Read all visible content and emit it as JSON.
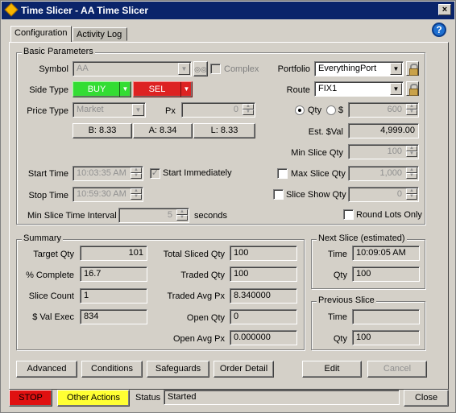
{
  "window": {
    "title": "Time Slicer - AA Time Slicer",
    "close_glyph": "×"
  },
  "tabs": [
    {
      "label": "Configuration"
    },
    {
      "label": "Activity Log"
    }
  ],
  "help_glyph": "?",
  "basic": {
    "group_label": "Basic Parameters",
    "symbol_label": "Symbol",
    "symbol_value": "AA",
    "complex_label": "Complex",
    "side_label": "Side Type",
    "buy_label": "BUY",
    "sell_label": "SEL",
    "price_type_label": "Price Type",
    "price_type_value": "Market",
    "px_label": "Px",
    "px_value": "0",
    "bid": "B: 8.33",
    "ask": "A: 8.34",
    "last": "L: 8.33",
    "start_time_label": "Start Time",
    "start_time_value": "10:03:35 AM",
    "start_immediately_label": "Start Immediately",
    "start_immediately_glyph": "✓",
    "stop_time_label": "Stop Time",
    "stop_time_value": "10:59:30 AM",
    "min_slice_interval_label": "Min Slice Time Interval",
    "min_slice_interval_value": "5",
    "seconds_label": "seconds",
    "portfolio_label": "Portfolio",
    "portfolio_value": "EverythingPort",
    "route_label": "Route",
    "route_value": "FIX1",
    "qty_label": "Qty",
    "dollar_label": "$",
    "qty_value": "600",
    "est_val_label": "Est. $Val",
    "est_val_value": "4,999.00",
    "min_slice_qty_label": "Min Slice Qty",
    "min_slice_qty_value": "100",
    "max_slice_qty_label": "Max Slice Qty",
    "max_slice_qty_value": "1,000",
    "slice_show_qty_label": "Slice Show Qty",
    "slice_show_qty_value": "0",
    "round_lots_label": "Round Lots Only"
  },
  "summary": {
    "group_label": "Summary",
    "target_qty_label": "Target Qty",
    "target_qty_value": "101",
    "pct_complete_label": "% Complete",
    "pct_complete_value": "16.7",
    "slice_count_label": "Slice Count",
    "slice_count_value": "1",
    "val_exec_label": "$ Val Exec",
    "val_exec_value": "834",
    "total_sliced_label": "Total Sliced Qty",
    "total_sliced_value": "100",
    "traded_qty_label": "Traded Qty",
    "traded_qty_value": "100",
    "traded_avg_px_label": "Traded Avg Px",
    "traded_avg_px_value": "8.340000",
    "open_qty_label": "Open Qty",
    "open_qty_value": "0",
    "open_avg_px_label": "Open Avg Px",
    "open_avg_px_value": "0.000000"
  },
  "next_slice": {
    "group_label": "Next Slice (estimated)",
    "time_label": "Time",
    "time_value": "10:09:05 AM",
    "qty_label": "Qty",
    "qty_value": "100"
  },
  "prev_slice": {
    "group_label": "Previous Slice",
    "time_label": "Time",
    "time_value": "",
    "qty_label": "Qty",
    "qty_value": "100"
  },
  "buttons": {
    "advanced": "Advanced",
    "conditions": "Conditions",
    "safeguards": "Safeguards",
    "order_detail": "Order Detail",
    "edit": "Edit",
    "cancel": "Cancel"
  },
  "footer": {
    "stop": "STOP",
    "other_actions": "Other Actions",
    "status_label": "Status",
    "status_value": "Started",
    "close": "Close"
  },
  "colors": {
    "title_bar": "#0a246a",
    "buy": "#33dd33",
    "sell": "#dd2222",
    "stop": "#e01010",
    "other_actions": "#ffff33"
  }
}
